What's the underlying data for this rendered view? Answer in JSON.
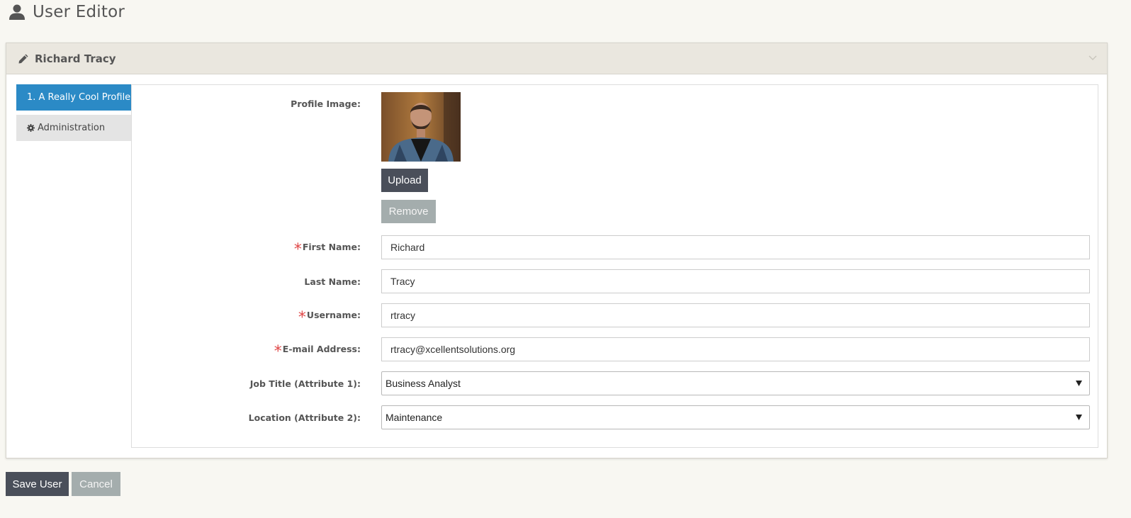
{
  "header": {
    "title": "User Editor",
    "icon": "user-icon"
  },
  "panel": {
    "title": "Richard Tracy",
    "icon": "pencil-icon",
    "collapse_icon": "chevron-down-icon"
  },
  "tabs": [
    {
      "label": "1. A Really Cool Profile",
      "active": true
    },
    {
      "label": "Administration",
      "icon": "gear-icon",
      "active": false
    }
  ],
  "form": {
    "profile_image_label": "Profile Image:",
    "upload_label": "Upload",
    "remove_label": "Remove",
    "first_name": {
      "label": "First Name:",
      "value": "Richard",
      "required": true
    },
    "last_name": {
      "label": "Last Name:",
      "value": "Tracy",
      "required": false
    },
    "username": {
      "label": "Username:",
      "value": "rtracy",
      "required": true
    },
    "email": {
      "label": "E-mail Address:",
      "value": "rtracy@xcellentsolutions.org",
      "required": true
    },
    "job_title": {
      "label": "Job Title (Attribute 1):",
      "value": "Business Analyst"
    },
    "location": {
      "label": "Location (Attribute 2):",
      "value": "Maintenance"
    }
  },
  "footer": {
    "save_label": "Save User",
    "cancel_label": "Cancel"
  },
  "colors": {
    "accent": "#2b8ac6",
    "required": "#e04848",
    "dark_button": "#4a4f5a",
    "gray_button": "#a4adad"
  }
}
